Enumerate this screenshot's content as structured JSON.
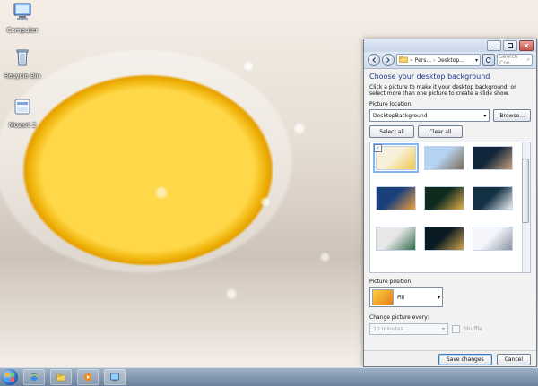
{
  "desktop": {
    "icons": [
      {
        "label": "Computer"
      },
      {
        "label": "Recycle Bin"
      },
      {
        "label": "Mozart 2"
      }
    ]
  },
  "window": {
    "address": {
      "segment1": "Pers...",
      "segment2": "Desktop..."
    },
    "search_placeholder": "Search Con...",
    "title": "Choose your desktop background",
    "description": "Click a picture to make it your desktop background, or select more than one picture to create a slide show.",
    "picture_location_label": "Picture location:",
    "picture_location_value": "DesktopBackground",
    "browse_label": "Browse...",
    "select_all_label": "Select all",
    "clear_all_label": "Clear all",
    "thumbnails": [
      {
        "colors": [
          "#f7f1dc",
          "#f1c84a"
        ],
        "selected": true
      },
      {
        "colors": [
          "#b5d3f2",
          "#7e6c55"
        ],
        "selected": false
      },
      {
        "colors": [
          "#11263b",
          "#caa37b"
        ],
        "selected": false
      },
      {
        "colors": [
          "#1b3f7b",
          "#f2a13a"
        ],
        "selected": false
      },
      {
        "colors": [
          "#0f2b1f",
          "#e6b14b"
        ],
        "selected": false
      },
      {
        "colors": [
          "#143043",
          "#f0f4f6"
        ],
        "selected": false
      },
      {
        "colors": [
          "#e7e7e7",
          "#2f6b47"
        ],
        "selected": false
      },
      {
        "colors": [
          "#0a1a23",
          "#d3a54a"
        ],
        "selected": false
      },
      {
        "colors": [
          "#f4f6fb",
          "#8a93a3"
        ],
        "selected": false
      }
    ],
    "picture_position_label": "Picture position:",
    "picture_position_value": "Fill",
    "change_picture_label": "Change picture every:",
    "change_picture_value": "10 minutes",
    "shuffle_label": "Shuffle",
    "save_label": "Save changes",
    "cancel_label": "Cancel"
  }
}
